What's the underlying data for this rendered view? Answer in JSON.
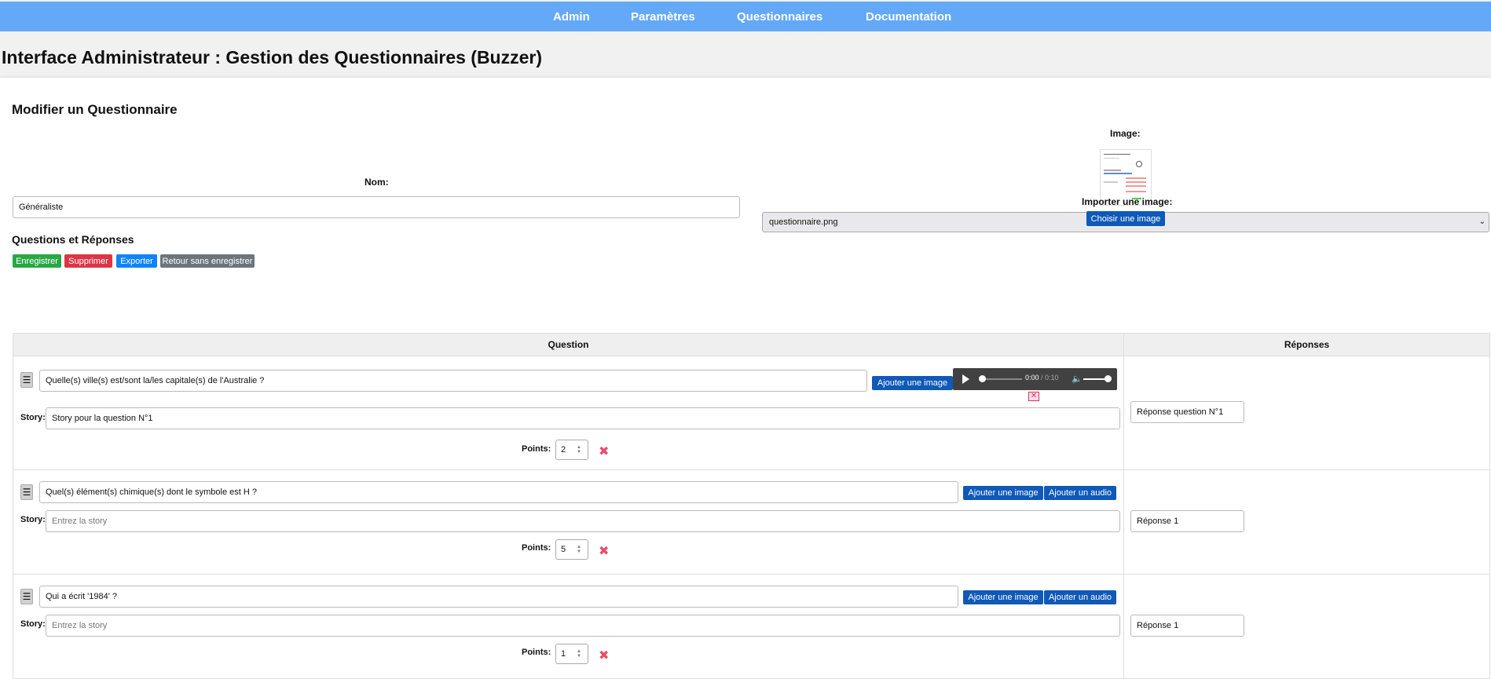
{
  "nav": {
    "items": [
      "Admin",
      "Paramètres",
      "Questionnaires",
      "Documentation"
    ]
  },
  "page": {
    "title": "Interface Administrateur : Gestion des Questionnaires (Buzzer)"
  },
  "editor": {
    "heading": "Modifier un Questionnaire",
    "name_label": "Nom:",
    "name_value": "Généraliste",
    "image_label": "Image:",
    "image_selected": "questionnaire.png",
    "import_label": "Importer une image:",
    "choose_image_button": "Choisir une image",
    "qa_heading": "Questions et Réponses",
    "actions": {
      "save": "Enregistrer",
      "delete": "Supprimer",
      "export": "Exporter",
      "back": "Retour sans enregistrer"
    }
  },
  "table": {
    "col_question": "Question",
    "col_answers": "Réponses",
    "story_label": "Story:",
    "points_label": "Points:",
    "story_placeholder": "Entrez la story",
    "add_image": "Ajouter une image",
    "add_audio": "Ajouter un audio",
    "rows": [
      {
        "question": "Quelle(s) ville(s) est/sont la/les capitale(s) de l'Australie ?",
        "story": "Story pour la question N°1",
        "points": "2",
        "answer": "Réponse question N°1",
        "audio_time": "0:00",
        "audio_duration": "0:10"
      },
      {
        "question": "Quel(s) élément(s) chimique(s) dont le symbole est H ?",
        "story": "",
        "points": "5",
        "answer": "Réponse 1"
      },
      {
        "question": "Qui a écrit '1984' ?",
        "story": "",
        "points": "1",
        "answer": "Réponse 1"
      }
    ]
  },
  "icons": {
    "handle": "drag-handle-icon",
    "delete": "close-icon",
    "play": "play-icon",
    "volume": "volume-icon"
  },
  "colors": {
    "nav_bg": "#64a9f8",
    "primary": "#0f59b8",
    "success": "#28a745",
    "danger": "#dc3545",
    "info": "#0d84f7",
    "secondary": "#6c757d",
    "delete_icon": "#e84d6a"
  }
}
